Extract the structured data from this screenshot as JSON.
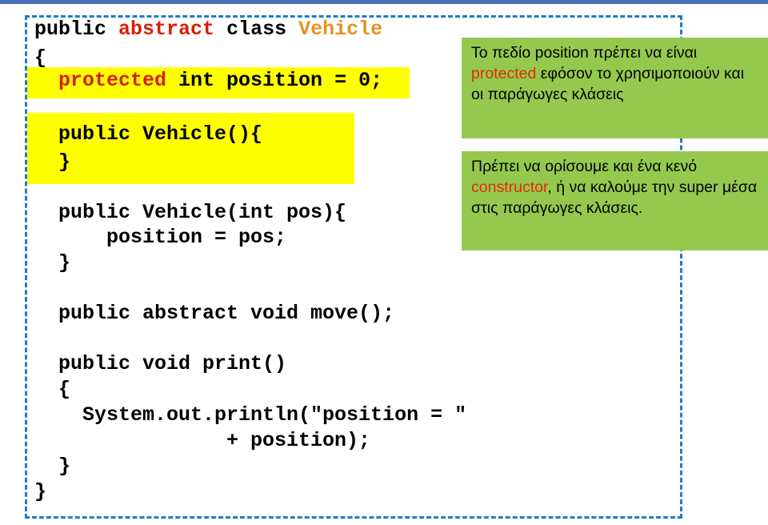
{
  "slide": {
    "accent_bar_color": "#4a72b8",
    "frame_border_color": "#1f7ec0",
    "highlight_color": "#ffff00",
    "note_background_color": "#95c94e",
    "keyword_color": "#d81e05",
    "type_color": "#e8911f"
  },
  "code": {
    "language": "java",
    "lines": [
      {
        "id": "line-class-decl",
        "indent": 0,
        "text": "public abstract class Vehicle",
        "tokens": [
          {
            "t": "public ",
            "c": "plain"
          },
          {
            "t": "abstract",
            "c": "keyword"
          },
          {
            "t": " class ",
            "c": "plain"
          },
          {
            "t": "Vehicle",
            "c": "type"
          }
        ]
      },
      {
        "id": "line-class-open",
        "indent": 0,
        "text": "{"
      },
      {
        "id": "line-field",
        "indent": 1,
        "text": "protected int position = 0;",
        "tokens": [
          {
            "t": "protected",
            "c": "keyword"
          },
          {
            "t": " int position = 0;",
            "c": "plain"
          }
        ]
      },
      {
        "id": "line-ctor-default",
        "indent": 1,
        "text": "public Vehicle(){"
      },
      {
        "id": "line-ctor-default-close",
        "indent": 1,
        "text": "}"
      },
      {
        "id": "line-ctor-pos",
        "indent": 1,
        "text": "public Vehicle(int pos){"
      },
      {
        "id": "line-ctor-pos-body",
        "indent": 2,
        "text": "position = pos;"
      },
      {
        "id": "line-ctor-pos-close",
        "indent": 1,
        "text": "}"
      },
      {
        "id": "line-move",
        "indent": 1,
        "text": "public abstract void move();"
      },
      {
        "id": "line-print-sig",
        "indent": 1,
        "text": "public void print()"
      },
      {
        "id": "line-print-open",
        "indent": 1,
        "text": "{"
      },
      {
        "id": "line-println-1",
        "indent": 2,
        "text": "System.out.println(\"position = \""
      },
      {
        "id": "line-println-2",
        "indent": 4,
        "text": "+ position);"
      },
      {
        "id": "line-print-close",
        "indent": 1,
        "text": "}"
      },
      {
        "id": "line-class-close",
        "indent": 0,
        "text": "}"
      }
    ]
  },
  "notes": [
    {
      "id": "note-protected",
      "segments": [
        {
          "t": "Το πεδίο position πρέπει να είναι ",
          "hl": false
        },
        {
          "t": "protected",
          "hl": true
        },
        {
          "t": " εφόσον το χρησιμοποιούν και οι παράγωγες κλάσεις",
          "hl": false
        }
      ],
      "plain": "Το πεδίο position πρέπει να είναι protected εφόσον το χρησιμοποιούν και οι παράγωγες κλάσεις"
    },
    {
      "id": "note-constructor",
      "segments": [
        {
          "t": "Πρέπει να ορίσουμε και ένα κενό ",
          "hl": false
        },
        {
          "t": "constructor",
          "hl": true
        },
        {
          "t": ", ή να καλούμε την super μέσα στις παράγωγες κλάσεις.",
          "hl": false
        }
      ],
      "plain": "Πρέπει να ορίσουμε και ένα κενό constructor, ή να καλούμε την super μέσα στις παράγωγες κλάσεις."
    }
  ],
  "text": {
    "class_decl_p1": "public ",
    "class_decl_abstract": "abstract",
    "class_decl_p2": " class ",
    "class_decl_name": "Vehicle",
    "brace_open": "{",
    "brace_close": "}",
    "field_protected": "protected",
    "field_rest": " int position = 0;",
    "ctor_default": "public Vehicle(){",
    "ctor_pos": "public Vehicle(int pos){",
    "ctor_pos_body": "position = pos;",
    "move_decl": "public abstract void move();",
    "print_sig": "public void print()",
    "println_1": "System.out.println(\"position = \"",
    "println_2": "+ position);",
    "note1_a": "Το πεδίο position πρέπει να είναι ",
    "note1_hl": "protected",
    "note1_b": " εφόσον το χρησιμοποιούν και οι παράγωγες κλάσεις",
    "note2_a": "Πρέπει να ορίσουμε και ένα κενό ",
    "note2_hl": "constructor",
    "note2_b": ", ή να καλούμε την super μέσα στις παράγωγες κλάσεις."
  }
}
